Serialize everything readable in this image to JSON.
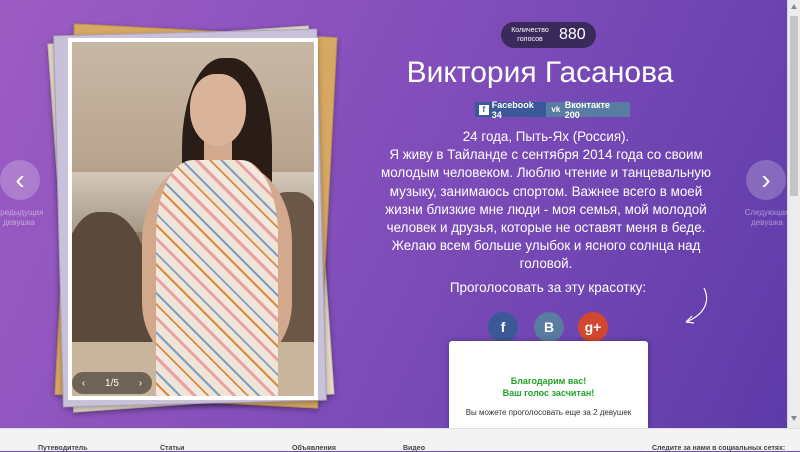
{
  "nav": {
    "prev_label": "Предыдущая девушка",
    "next_label": "Следующая девушка",
    "prev_icon": "chevron-left-icon",
    "next_icon": "chevron-right-icon"
  },
  "photo": {
    "pager": "1/5"
  },
  "votes": {
    "label": "Количество голосов",
    "count": "880"
  },
  "profile": {
    "name": "Виктория Гасанова",
    "age_location": "24 года, Пыть-Ях (Россия).",
    "bio": "Я живу в Тайланде с сентября 2014 года со своим молодым человеком. Люблю чтение и танцевальную музыку, занимаюсь спортом. Важнее всего в моей жизни близкие мне люди - моя семья, мой молодой человек и друзья, которые не оставят меня в беде. Желаю всем больше улыбок и ясного солнца над головой."
  },
  "share": {
    "facebook": "Facebook 34",
    "vkontakte": "Вконтакте 200"
  },
  "vote": {
    "title": "Проголосовать за эту красотку:",
    "fb": "f",
    "vk": "B",
    "gp": "g+"
  },
  "thanks": {
    "line1": "Благодарим вас!",
    "line2": "Ваш голос засчитан!",
    "line3": "Вы можете проголосовать еще за 2 девушек"
  },
  "footer": {
    "items": [
      "Путеводитель",
      "Статьи",
      "Объявления",
      "Видео",
      "",
      "Следите за нами в социальных сетях:"
    ]
  },
  "colors": {
    "bg_start": "#9c5cc3",
    "bg_end": "#5c3aa8",
    "facebook": "#3b5998",
    "vkontakte": "#5a7ba2",
    "googleplus": "#d3472f",
    "success": "#22a12a"
  }
}
